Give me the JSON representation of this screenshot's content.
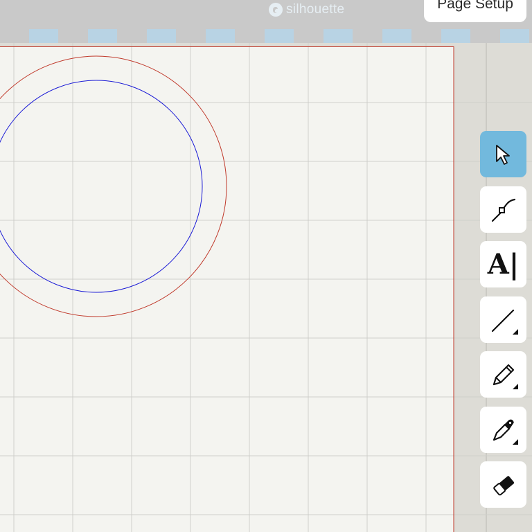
{
  "header": {
    "logo_text": "silhouette",
    "page_setup_label": "Page Setup"
  },
  "colors": {
    "toolbar_bg": "#c9c9c9",
    "ruler_tick": "#b8d3e4",
    "mat_bg": "#f4f4f0",
    "grid_line": "#cfcfcb",
    "page_border": "#c0392b",
    "outer_circle": "#c0392b",
    "inner_circle": "#1a1ad6",
    "active_tool": "#72b9dd"
  },
  "canvas": {
    "shapes": [
      {
        "kind": "circle",
        "name": "outer-circle",
        "color": "#c0392b"
      },
      {
        "kind": "circle",
        "name": "inner-circle",
        "color": "#1a1ad6"
      }
    ]
  },
  "tools": [
    {
      "name": "select-tool",
      "icon": "pointer-arrow-icon",
      "active": true
    },
    {
      "name": "edit-points-tool",
      "icon": "edit-points-icon",
      "active": false
    },
    {
      "name": "text-tool",
      "icon": "text-icon",
      "label": "A",
      "active": false
    },
    {
      "name": "line-tool",
      "icon": "line-icon",
      "active": false,
      "has_submenu": true
    },
    {
      "name": "draw-tool",
      "icon": "pencil-icon",
      "active": false,
      "has_submenu": true
    },
    {
      "name": "knife-tool",
      "icon": "knife-icon",
      "active": false,
      "has_submenu": true
    },
    {
      "name": "eraser-tool",
      "icon": "eraser-icon",
      "active": false
    }
  ]
}
